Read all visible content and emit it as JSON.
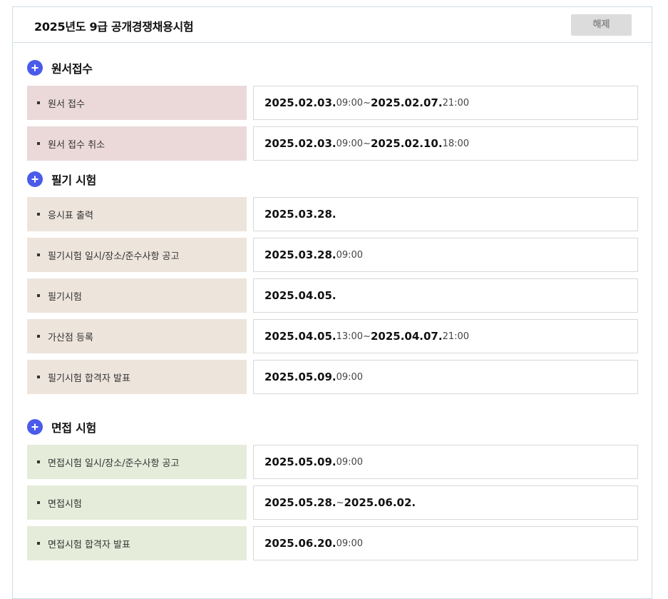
{
  "header": {
    "title": "2025년도 9급 공개경쟁채용시험",
    "release_label": "해제"
  },
  "colors": {
    "accent": "#4a5bea",
    "apply_bg": "#ebd9d9",
    "written_bg": "#ede4dc",
    "interview_bg": "#e5ecda",
    "border": "#cfdce6"
  },
  "sections": [
    {
      "title": "원서접수",
      "icon": "plus-circle-icon",
      "rows": [
        {
          "label": "원서 접수",
          "start_date": "2025.02.03.",
          "start_time": "09:00",
          "sep": "~",
          "end_date": "2025.02.07.",
          "end_time": "21:00"
        },
        {
          "label": "원서 접수 취소",
          "start_date": "2025.02.03.",
          "start_time": "09:00",
          "sep": "~",
          "end_date": "2025.02.10.",
          "end_time": "18:00"
        }
      ]
    },
    {
      "title": "필기 시험",
      "icon": "plus-circle-icon",
      "rows": [
        {
          "label": "응시표 출력",
          "start_date": "2025.03.28."
        },
        {
          "label": "필기시험 일시/장소/준수사항 공고",
          "start_date": "2025.03.28.",
          "start_time": "09:00"
        },
        {
          "label": "필기시험",
          "start_date": "2025.04.05."
        },
        {
          "label": "가산점 등록",
          "start_date": "2025.04.05.",
          "start_time": "13:00",
          "sep": "~",
          "end_date": "2025.04.07.",
          "end_time": "21:00"
        },
        {
          "label": "필기시험 합격자 발표",
          "start_date": "2025.05.09.",
          "start_time": "09:00"
        }
      ]
    },
    {
      "title": "면접 시험",
      "icon": "plus-circle-icon",
      "rows": [
        {
          "label": "면접시험 일시/장소/준수사항 공고",
          "start_date": "2025.05.09.",
          "start_time": "09:00"
        },
        {
          "label": "면접시험",
          "start_date": "2025.05.28.",
          "sep": "~",
          "end_date": "2025.06.02."
        },
        {
          "label": "면접시험 합격자 발표",
          "start_date": "2025.06.20.",
          "start_time": "09:00"
        }
      ]
    }
  ]
}
